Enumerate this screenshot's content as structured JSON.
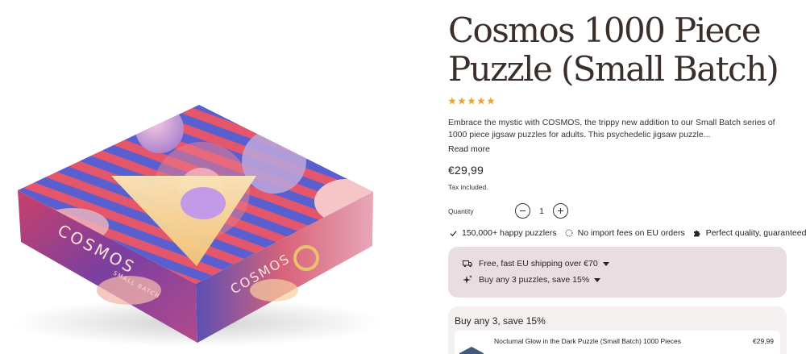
{
  "product": {
    "title": "Cosmos 1000 Piece Puzzle (Small Batch)",
    "rating": 5,
    "description": "Embrace the mystic with COSMOS, the trippy new addition to our Small Batch series of 1000 piece jigsaw puzzles for adults. This psychedelic jigsaw puzzle...",
    "read_more": "Read more",
    "price": "€29,99",
    "tax_note": "Tax included.",
    "box_text": {
      "brand": "COSMOS",
      "side": "SMALL BATCH",
      "logo": "COSMOS"
    }
  },
  "quantity": {
    "label": "Quantity",
    "value": "1"
  },
  "features": [
    {
      "icon": "check-icon",
      "label": "150,000+ happy puzzlers"
    },
    {
      "icon": "dotted-circle-icon",
      "label": "No import fees on EU orders"
    },
    {
      "icon": "puzzle-piece-icon",
      "label": "Perfect quality, guaranteed"
    }
  ],
  "promo": {
    "shipping": {
      "icon": "truck-icon",
      "label": "Free, fast EU shipping over €70"
    },
    "bundle": {
      "icon": "sparkle-icon",
      "label": "Buy any 3 puzzles, save 15%"
    }
  },
  "bundle_offer": {
    "title": "Buy any 3, save 15%",
    "items": [
      {
        "name": "Nocturnal Glow in the Dark Puzzle (Small Batch) 1000 Pieces",
        "price": "€29,99"
      }
    ]
  },
  "colors": {
    "text": "#2b2320",
    "star": "#e7a935",
    "promo_bg": "#eadde1",
    "bundle_bg": "#f4f1f0"
  }
}
